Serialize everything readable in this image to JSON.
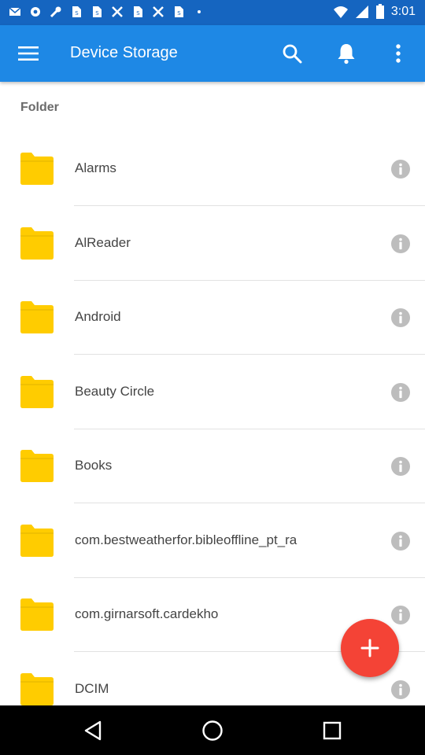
{
  "status_bar": {
    "time": "3:01",
    "icons": [
      "mail-icon",
      "settings-icon",
      "wrench-icon",
      "sim-icon",
      "sim-icon",
      "tools-icon",
      "sim-icon",
      "tools-icon",
      "sim-icon",
      "dot-icon"
    ]
  },
  "app_bar": {
    "title": "Device Storage",
    "actions": [
      "search-icon",
      "notification-bell-icon",
      "more-vert-icon"
    ]
  },
  "section_label": "Folder",
  "folders": [
    {
      "label": "Alarms"
    },
    {
      "label": "AlReader"
    },
    {
      "label": "Android"
    },
    {
      "label": "Beauty Circle"
    },
    {
      "label": "Books"
    },
    {
      "label": "com.bestweatherfor.bibleoffline_pt_ra"
    },
    {
      "label": "com.girnarsoft.cardekho"
    },
    {
      "label": "DCIM"
    }
  ],
  "fab": {
    "icon": "plus-icon"
  },
  "colors": {
    "primary": "#1e88e5",
    "primary_dark": "#1565c0",
    "accent": "#f44336",
    "folder": "#ffcc00"
  }
}
